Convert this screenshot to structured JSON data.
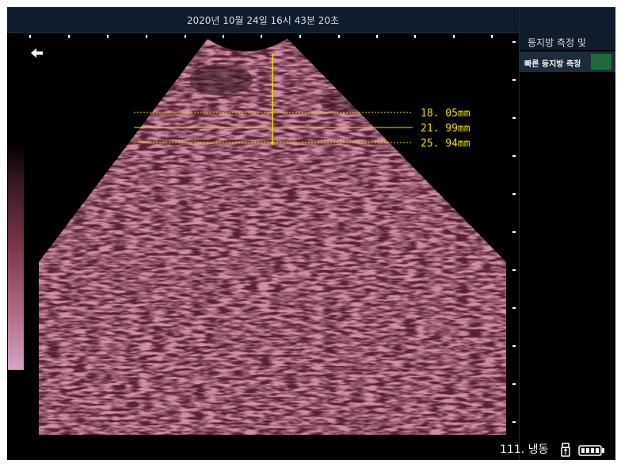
{
  "header": {
    "datetime": "2020년 10월 24일 16시 43분 20초"
  },
  "side_panel": {
    "title": "등지방 측정 및",
    "subtitle": "빠른 등지방 측정",
    "swatch_color": "#1f6a3b"
  },
  "measurements": [
    "18. 05mm",
    "21. 99mm",
    "25. 94mm"
  ],
  "status": {
    "text": "111. 냉동"
  },
  "icons": {
    "back": "back-arrow-icon",
    "usb": "usb-icon",
    "battery": "battery-icon"
  },
  "colors": {
    "ultrasound": "#8a3a52",
    "measure_line": "#f0e000",
    "topbar": "#0f1c2b"
  }
}
